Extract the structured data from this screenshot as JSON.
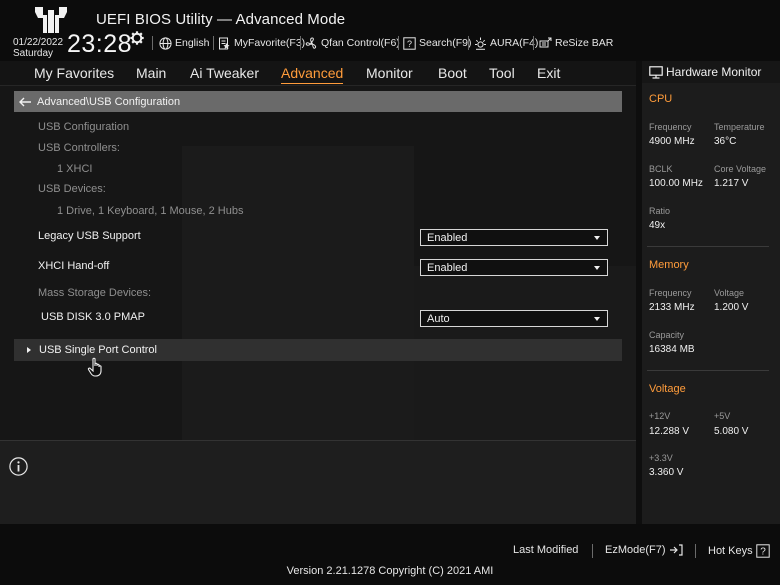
{
  "header": {
    "title": "UEFI BIOS Utility — Advanced Mode",
    "date": "01/22/2022",
    "day": "Saturday",
    "time": "23:28",
    "tools": {
      "language": "English",
      "myfavorite": "MyFavorite(F3)",
      "qfan": "Qfan Control(F6)",
      "search": "Search(F9)",
      "aura": "AURA(F4)",
      "resize_bar": "ReSize BAR"
    }
  },
  "menu": {
    "items": [
      "My Favorites",
      "Main",
      "Ai Tweaker",
      "Advanced",
      "Monitor",
      "Boot",
      "Tool",
      "Exit"
    ],
    "active": "Advanced"
  },
  "content": {
    "breadcrumb": "Advanced\\USB Configuration",
    "usb_configuration": "USB Configuration",
    "usb_controllers_label": "USB Controllers:",
    "usb_controllers_value": "1 XHCI",
    "usb_devices_label": "USB Devices:",
    "usb_devices_value": "1 Drive, 1 Keyboard, 1 Mouse, 2 Hubs",
    "legacy_usb_label": "Legacy USB Support",
    "legacy_usb_value": "Enabled",
    "xhci_label": "XHCI Hand-off",
    "xhci_value": "Enabled",
    "mass_storage_label": "Mass Storage Devices:",
    "usb_disk_label": "USB DISK 3.0 PMAP",
    "usb_disk_value": "Auto",
    "submenu_label": "USB Single Port Control"
  },
  "hardware_monitor": {
    "title": "Hardware Monitor",
    "cpu": {
      "heading": "CPU",
      "frequency_label": "Frequency",
      "frequency_value": "4900 MHz",
      "temperature_label": "Temperature",
      "temperature_value": "36°C",
      "bclk_label": "BCLK",
      "bclk_value": "100.00 MHz",
      "core_voltage_label": "Core Voltage",
      "core_voltage_value": "1.217 V",
      "ratio_label": "Ratio",
      "ratio_value": "49x"
    },
    "memory": {
      "heading": "Memory",
      "frequency_label": "Frequency",
      "frequency_value": "2133 MHz",
      "voltage_label": "Voltage",
      "voltage_value": "1.200 V",
      "capacity_label": "Capacity",
      "capacity_value": "16384 MB"
    },
    "voltage": {
      "heading": "Voltage",
      "v12_label": "+12V",
      "v12_value": "12.288 V",
      "v5_label": "+5V",
      "v5_value": "5.080 V",
      "v33_label": "+3.3V",
      "v33_value": "3.360 V"
    }
  },
  "footer": {
    "last_modified": "Last Modified",
    "ezmode": "EzMode(F7)",
    "hotkeys": "Hot Keys",
    "version": "Version 2.21.1278 Copyright (C) 2021 AMI"
  },
  "colors": {
    "accent": "#ff9c3b",
    "background": "#0e0e0e",
    "panel": "#161616",
    "breadcrumb_bar": "#6a6a6a"
  }
}
